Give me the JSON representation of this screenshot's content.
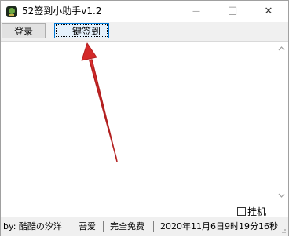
{
  "window": {
    "title": "52签到小助手v1.2"
  },
  "titlebar": {
    "minimize_glyph": "—",
    "maximize_glyph": "☐",
    "close_glyph": "✕"
  },
  "toolbar": {
    "login_label": "登录",
    "sign_label": "一键签到"
  },
  "options": {
    "hang_label": "挂机",
    "hang_checked": false
  },
  "status": {
    "author": "by: 酷酷の汐洋",
    "forum": "吾爱",
    "free": "完全免费",
    "datetime": "2020年11月6日9时19分16秒"
  },
  "colors": {
    "arrow": "#d42a2a",
    "accent": "#0078d7"
  }
}
